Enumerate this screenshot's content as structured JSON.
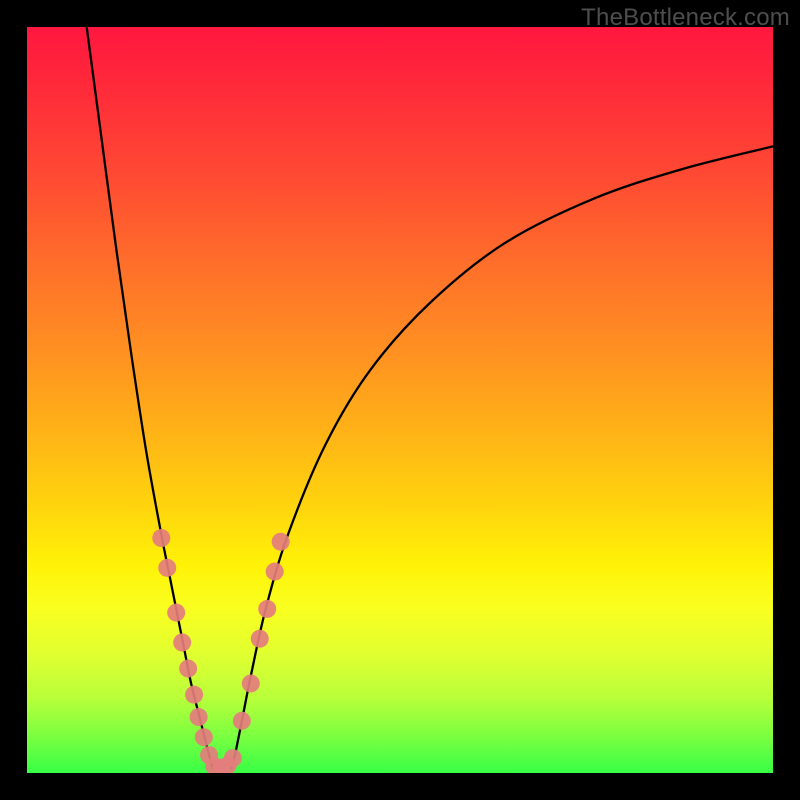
{
  "watermark": "TheBottleneck.com",
  "chart_data": {
    "type": "line",
    "title": "",
    "xlabel": "",
    "ylabel": "",
    "xlim": [
      0,
      100
    ],
    "ylim": [
      0,
      100
    ],
    "grid": false,
    "legend": false,
    "series": [
      {
        "name": "curve-left",
        "type": "line",
        "x": [
          8,
          10,
          12,
          14,
          16,
          18,
          19,
          20,
          21,
          22,
          23,
          24,
          24.9
        ],
        "y": [
          100,
          85,
          70,
          56,
          43,
          32,
          27,
          22,
          17,
          12,
          8,
          4,
          0.5
        ]
      },
      {
        "name": "curve-right",
        "type": "line",
        "x": [
          27.4,
          28,
          29,
          30,
          32,
          35,
          40,
          46,
          54,
          64,
          76,
          88,
          100
        ],
        "y": [
          0.5,
          3,
          8,
          13,
          22,
          32,
          44,
          54,
          63,
          71,
          77,
          81,
          84
        ]
      },
      {
        "name": "dots-left-branch",
        "type": "scatter",
        "x": [
          18.0,
          18.8,
          20.0,
          20.8,
          21.6,
          22.4,
          23.0,
          23.7,
          24.4,
          25.1
        ],
        "y": [
          31.5,
          27.5,
          21.5,
          17.5,
          14.0,
          10.5,
          7.5,
          4.8,
          2.4,
          0.9
        ]
      },
      {
        "name": "dots-right-branch",
        "type": "scatter",
        "x": [
          26.0,
          26.9,
          27.6,
          28.8,
          30.0,
          31.2,
          32.2,
          33.2,
          34.0
        ],
        "y": [
          0.7,
          1.0,
          2.0,
          7.0,
          12.0,
          18.0,
          22.0,
          27.0,
          31.0
        ]
      }
    ],
    "colors": {
      "curve": "#000000",
      "dots": "#e47d7d",
      "gradient_top": "#ff173f",
      "gradient_bottom": "#37ff46"
    }
  }
}
